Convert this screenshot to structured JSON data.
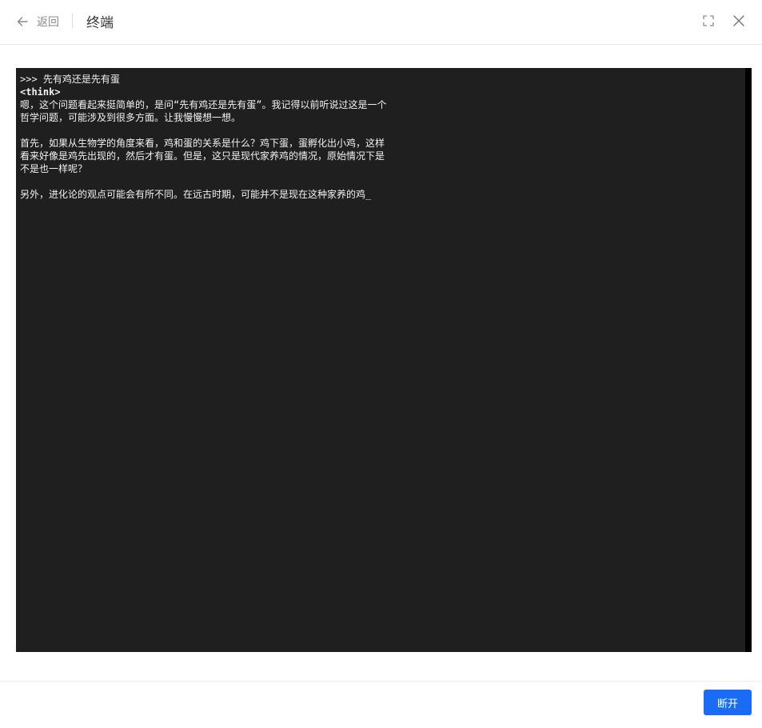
{
  "header": {
    "back_label": "返回",
    "title": "终端",
    "icons": {
      "back": "arrow-left-icon",
      "fullscreen": "fullscreen-icon",
      "close": "close-icon"
    }
  },
  "terminal": {
    "background": "#1f1f1f",
    "text_color": "#f2f2f2",
    "lines": [
      ">>> 先有鸡还是先有蛋",
      "<think>",
      "嗯，这个问题看起来挺简单的，是问“先有鸡还是先有蛋”。我记得以前听说过这是一个",
      "哲学问题，可能涉及到很多方面。让我慢慢想一想。",
      "",
      "首先，如果从生物学的角度来看，鸡和蛋的关系是什么？鸡下蛋，蛋孵化出小鸡，这样",
      "看来好像是鸡先出现的，然后才有蛋。但是，这只是现代家养鸡的情况，原始情况下是",
      "不是也一样呢？",
      "",
      "另外，进化论的观点可能会有所不同。在远古时期，可能并不是现在这种家养的鸡_"
    ]
  },
  "footer": {
    "disconnect_label": "断开",
    "accent_color": "#1a6cf5"
  }
}
